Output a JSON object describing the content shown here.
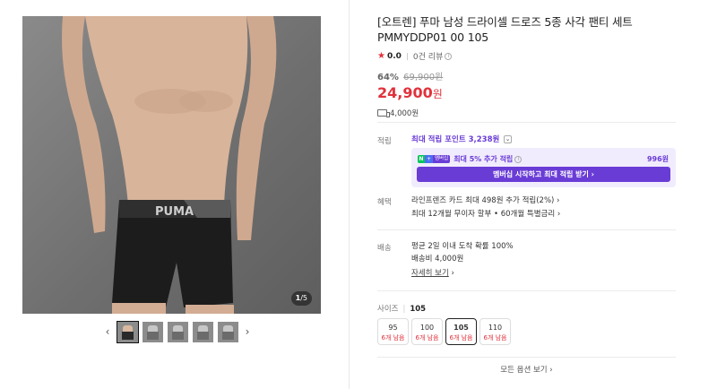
{
  "gallery": {
    "counter_current": "1",
    "counter_total": "/5",
    "prev_arrow": "‹",
    "next_arrow": "›",
    "thumbnails": [
      "thumb-1",
      "thumb-2",
      "thumb-3",
      "thumb-4",
      "thumb-5"
    ]
  },
  "product": {
    "title": "[오트렌] 푸마 남성 드라이셀 드로즈 5종 사각 팬티 세트 PMMYDDP01 00 105",
    "rating": "0.0",
    "review_count": "0건 리뷰",
    "discount": "64%",
    "original_price": "69,900원",
    "price": "24,900",
    "price_unit": "원",
    "shipping_fee": "4,000원"
  },
  "points": {
    "label": "적립",
    "max_points": "최대 적립 포인트 3,238원",
    "membership_badge_n": "N",
    "membership_badge_plus": "+",
    "membership_badge_text": "멤버십",
    "membership_text": "최대 5% 추가 적립",
    "membership_amount": "996원",
    "membership_button": "멤버십 시작하고 최대 적립 받기 ›"
  },
  "benefits": {
    "label": "혜택",
    "line1": "라인프렌즈 카드 최대 498원 추가 적립(2%) ›",
    "line2": "최대 12개월 무이자 할부 • 60개월 특별금리 ›"
  },
  "delivery": {
    "label": "배송",
    "line1": "평균 2일 이내 도착 확률 100%",
    "line2": "배송비 4,000원",
    "more": "자세히 보기"
  },
  "size": {
    "label": "사이즈",
    "selected": "105",
    "options": [
      {
        "size": "95",
        "stock": "6개 남음"
      },
      {
        "size": "100",
        "stock": "6개 남음"
      },
      {
        "size": "105",
        "stock": "6개 남음"
      },
      {
        "size": "110",
        "stock": "6개 남음"
      }
    ]
  },
  "all_options": "모든 옵션 보기 ›",
  "colors": {
    "price_red": "#e0323c",
    "accent_purple": "#6a3cd6"
  }
}
